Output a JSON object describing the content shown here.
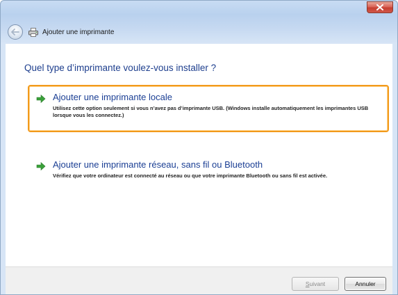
{
  "window": {
    "title": "Ajouter une imprimante"
  },
  "main": {
    "heading": "Quel type d’imprimante voulez-vous installer ?",
    "options": [
      {
        "title": "Ajouter une imprimante locale",
        "description": "Utilisez cette option seulement si vous n’avez pas d’imprimante USB. (Windows installe automatiquement les imprimantes USB lorsque vous les connectez.)",
        "selected": true
      },
      {
        "title": "Ajouter une imprimante réseau, sans fil ou Bluetooth",
        "description": "Vérifiez que votre ordinateur est connecté au réseau ou que votre imprimante Bluetooth ou sans fil est activée.",
        "selected": false
      }
    ]
  },
  "footer": {
    "next_first_letter": "S",
    "next_rest": "uivant",
    "cancel_label": "Annuler"
  },
  "colors": {
    "accent_text": "#1b3f94",
    "selection_border": "#f29a1c",
    "arrow_green": "#3aa13a"
  },
  "icons": {
    "close": "close-icon",
    "back": "back-arrow-icon",
    "printer": "printer-icon",
    "option_arrow": "green-arrow-icon"
  }
}
